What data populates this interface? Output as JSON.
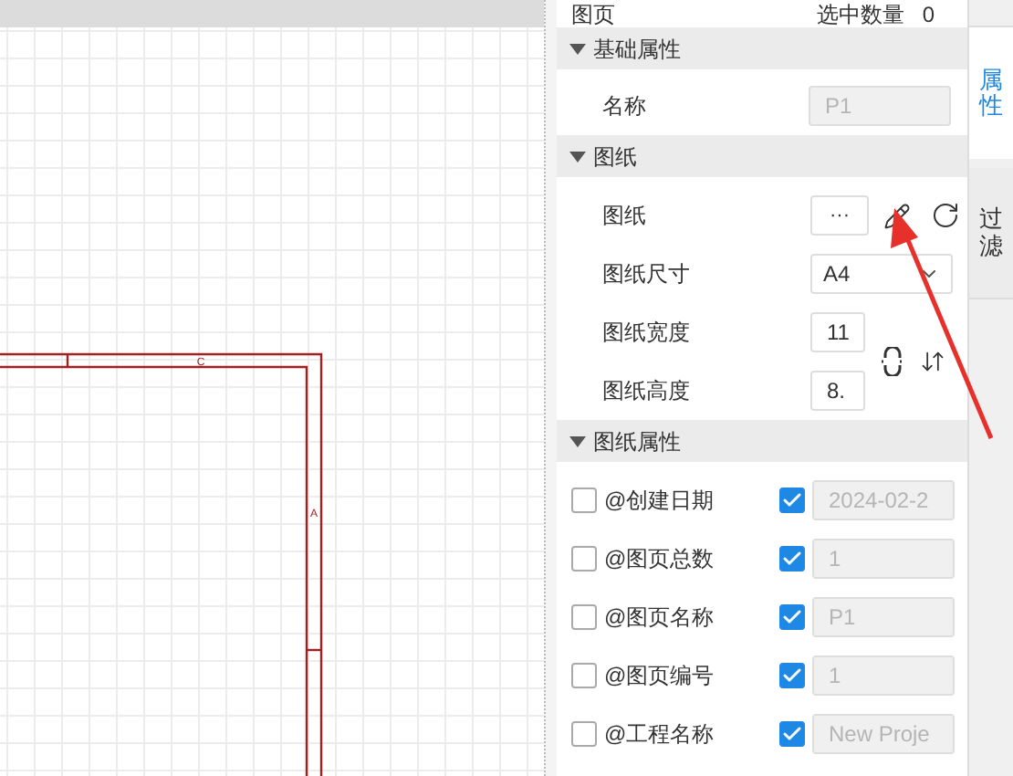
{
  "header": {
    "label": "图页",
    "count_label": "选中数量",
    "count": "0"
  },
  "canvas": {
    "zone_labels": [
      "C",
      "A"
    ]
  },
  "sections": [
    {
      "title": "基础属性",
      "expanded": true,
      "rows": [
        {
          "kind": "field",
          "label": "名称",
          "value": "P1",
          "disabled": true
        }
      ]
    },
    {
      "title": "图纸",
      "expanded": true,
      "rows": [
        {
          "kind": "picker",
          "label": "图纸",
          "value": "···"
        },
        {
          "kind": "select",
          "label": "图纸尺寸",
          "value": "A4"
        },
        {
          "kind": "number",
          "label": "图纸宽度",
          "value": "11",
          "disabled": false
        },
        {
          "kind": "number",
          "label": "图纸高度",
          "value": "8.",
          "disabled": false
        }
      ]
    },
    {
      "title": "图纸属性",
      "expanded": true,
      "rows": [
        {
          "kind": "attribute",
          "label": "@创建日期",
          "checked": false,
          "visible": true,
          "value": "2024-02-2",
          "disabled": true
        },
        {
          "kind": "attribute",
          "label": "@图页总数",
          "checked": false,
          "visible": true,
          "value": "1",
          "disabled": true
        },
        {
          "kind": "attribute",
          "label": "@图页名称",
          "checked": false,
          "visible": true,
          "value": "P1",
          "disabled": true
        },
        {
          "kind": "attribute",
          "label": "@图页编号",
          "checked": false,
          "visible": true,
          "value": "1",
          "disabled": true
        },
        {
          "kind": "attribute",
          "label": "@工程名称",
          "checked": false,
          "visible": true,
          "value": "New Proje",
          "disabled": true
        }
      ]
    }
  ],
  "tabs": [
    {
      "label": "属性",
      "selected": true
    },
    {
      "label": "过滤",
      "selected": false
    }
  ]
}
